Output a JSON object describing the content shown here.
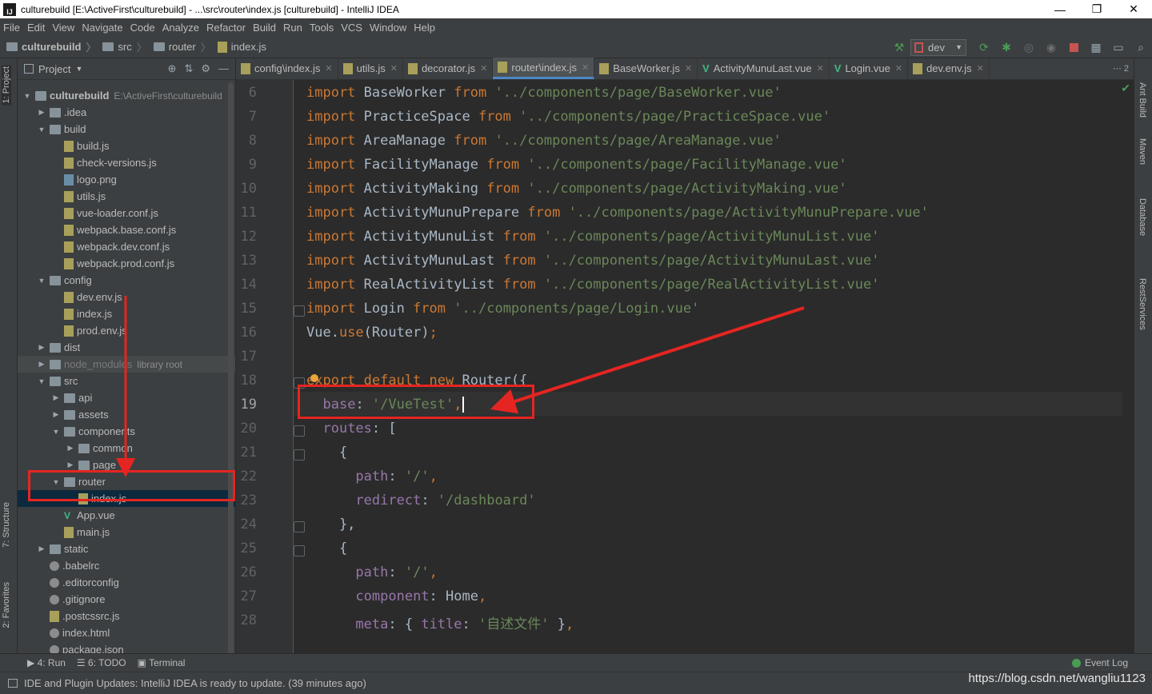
{
  "window": {
    "title": "culturebuild [E:\\ActiveFirst\\culturebuild] - ...\\src\\router\\index.js [culturebuild] - IntelliJ IDEA",
    "minimize": "—",
    "maximize": "❐",
    "close": "✕",
    "app_icon": "IJ"
  },
  "menu": [
    "File",
    "Edit",
    "View",
    "Navigate",
    "Code",
    "Analyze",
    "Refactor",
    "Build",
    "Run",
    "Tools",
    "VCS",
    "Window",
    "Help"
  ],
  "breadcrumb": {
    "project": "culturebuild",
    "folder1": "src",
    "folder2": "router",
    "file": "index.js"
  },
  "toolbar": {
    "run_config": "dev",
    "icons": [
      "hammer-icon",
      "run-icon",
      "debug-icon",
      "coverage-icon",
      "profile-icon",
      "stop-icon",
      "project-structure-icon",
      "layout-icon",
      "search-everywhere-icon"
    ]
  },
  "left_stripe": {
    "project": "1: Project",
    "structure": "7: Structure",
    "favorites": "2: Favorites"
  },
  "project_panel": {
    "title": "Project",
    "tree": [
      {
        "label": "culturebuild",
        "sub": "E:\\ActiveFirst\\culturebuild",
        "depth": 0,
        "arrow": "▼",
        "icon": "folder",
        "bold": true
      },
      {
        "label": ".idea",
        "depth": 1,
        "arrow": "▶",
        "icon": "folder"
      },
      {
        "label": "build",
        "depth": 1,
        "arrow": "▼",
        "icon": "folder"
      },
      {
        "label": "build.js",
        "depth": 2,
        "arrow": "",
        "icon": "js"
      },
      {
        "label": "check-versions.js",
        "depth": 2,
        "arrow": "",
        "icon": "js"
      },
      {
        "label": "logo.png",
        "depth": 2,
        "arrow": "",
        "icon": "png"
      },
      {
        "label": "utils.js",
        "depth": 2,
        "arrow": "",
        "icon": "js"
      },
      {
        "label": "vue-loader.conf.js",
        "depth": 2,
        "arrow": "",
        "icon": "js"
      },
      {
        "label": "webpack.base.conf.js",
        "depth": 2,
        "arrow": "",
        "icon": "js"
      },
      {
        "label": "webpack.dev.conf.js",
        "depth": 2,
        "arrow": "",
        "icon": "js"
      },
      {
        "label": "webpack.prod.conf.js",
        "depth": 2,
        "arrow": "",
        "icon": "js"
      },
      {
        "label": "config",
        "depth": 1,
        "arrow": "▼",
        "icon": "folder"
      },
      {
        "label": "dev.env.js",
        "depth": 2,
        "arrow": "",
        "icon": "js"
      },
      {
        "label": "index.js",
        "depth": 2,
        "arrow": "",
        "icon": "js"
      },
      {
        "label": "prod.env.js",
        "depth": 2,
        "arrow": "",
        "icon": "js"
      },
      {
        "label": "dist",
        "depth": 1,
        "arrow": "▶",
        "icon": "folder"
      },
      {
        "label": "node_modules",
        "sub": "library root",
        "depth": 1,
        "arrow": "▶",
        "icon": "folder",
        "dim": true
      },
      {
        "label": "src",
        "depth": 1,
        "arrow": "▼",
        "icon": "folder"
      },
      {
        "label": "api",
        "depth": 2,
        "arrow": "▶",
        "icon": "folder"
      },
      {
        "label": "assets",
        "depth": 2,
        "arrow": "▶",
        "icon": "folder"
      },
      {
        "label": "components",
        "depth": 2,
        "arrow": "▼",
        "icon": "folder"
      },
      {
        "label": "common",
        "depth": 3,
        "arrow": "▶",
        "icon": "folder"
      },
      {
        "label": "page",
        "depth": 3,
        "arrow": "▶",
        "icon": "folder"
      },
      {
        "label": "router",
        "depth": 2,
        "arrow": "▼",
        "icon": "folder"
      },
      {
        "label": "index.js",
        "depth": 3,
        "arrow": "",
        "icon": "js",
        "selected": true
      },
      {
        "label": "App.vue",
        "depth": 2,
        "arrow": "",
        "icon": "vue"
      },
      {
        "label": "main.js",
        "depth": 2,
        "arrow": "",
        "icon": "js"
      },
      {
        "label": "static",
        "depth": 1,
        "arrow": "▶",
        "icon": "folder"
      },
      {
        "label": ".babelrc",
        "depth": 1,
        "arrow": "",
        "icon": "cfg"
      },
      {
        "label": ".editorconfig",
        "depth": 1,
        "arrow": "",
        "icon": "cfg"
      },
      {
        "label": ".gitignore",
        "depth": 1,
        "arrow": "",
        "icon": "cfg"
      },
      {
        "label": ".postcssrc.js",
        "depth": 1,
        "arrow": "",
        "icon": "js"
      },
      {
        "label": "index.html",
        "depth": 1,
        "arrow": "",
        "icon": "cfg"
      },
      {
        "label": "package.json",
        "depth": 1,
        "arrow": "",
        "icon": "cfg"
      }
    ]
  },
  "tabs": [
    {
      "label": "config\\index.js",
      "icon": "js"
    },
    {
      "label": "utils.js",
      "icon": "js"
    },
    {
      "label": "decorator.js",
      "icon": "js"
    },
    {
      "label": "router\\index.js",
      "icon": "js",
      "active": true
    },
    {
      "label": "BaseWorker.js",
      "icon": "js"
    },
    {
      "label": "ActivityMunuLast.vue",
      "icon": "vue"
    },
    {
      "label": "Login.vue",
      "icon": "vue"
    },
    {
      "label": "dev.env.js",
      "icon": "js"
    }
  ],
  "tabs_more": "⋯ 2",
  "editor": {
    "current_line": 19,
    "lines": [
      {
        "n": "6",
        "tokens": [
          [
            "kw",
            "import"
          ],
          [
            "t",
            " BaseWorker "
          ],
          [
            "kw",
            "from"
          ],
          [
            "t",
            " "
          ],
          [
            "str",
            "'../components/page/BaseWorker.vue'"
          ]
        ]
      },
      {
        "n": "7",
        "tokens": [
          [
            "kw",
            "import"
          ],
          [
            "t",
            " PracticeSpace "
          ],
          [
            "kw",
            "from"
          ],
          [
            "t",
            " "
          ],
          [
            "str",
            "'../components/page/PracticeSpace.vue'"
          ]
        ]
      },
      {
        "n": "8",
        "tokens": [
          [
            "kw",
            "import"
          ],
          [
            "t",
            " AreaManage "
          ],
          [
            "kw",
            "from"
          ],
          [
            "t",
            " "
          ],
          [
            "str",
            "'../components/page/AreaManage.vue'"
          ]
        ]
      },
      {
        "n": "9",
        "tokens": [
          [
            "kw",
            "import"
          ],
          [
            "t",
            " FacilityManage "
          ],
          [
            "kw",
            "from"
          ],
          [
            "t",
            " "
          ],
          [
            "str",
            "'../components/page/FacilityManage.vue'"
          ]
        ]
      },
      {
        "n": "10",
        "tokens": [
          [
            "kw",
            "import"
          ],
          [
            "t",
            " ActivityMaking "
          ],
          [
            "kw",
            "from"
          ],
          [
            "t",
            " "
          ],
          [
            "str",
            "'../components/page/ActivityMaking.vue'"
          ]
        ]
      },
      {
        "n": "11",
        "tokens": [
          [
            "kw",
            "import"
          ],
          [
            "t",
            " ActivityMunuPrepare "
          ],
          [
            "kw",
            "from"
          ],
          [
            "t",
            " "
          ],
          [
            "str",
            "'../components/page/ActivityMunuPrepare.vue'"
          ]
        ]
      },
      {
        "n": "12",
        "tokens": [
          [
            "kw",
            "import"
          ],
          [
            "t",
            " ActivityMunuList "
          ],
          [
            "kw",
            "from"
          ],
          [
            "t",
            " "
          ],
          [
            "str",
            "'../components/page/ActivityMunuList.vue'"
          ]
        ]
      },
      {
        "n": "13",
        "tokens": [
          [
            "kw",
            "import"
          ],
          [
            "t",
            " ActivityMunuLast "
          ],
          [
            "kw",
            "from"
          ],
          [
            "t",
            " "
          ],
          [
            "str",
            "'../components/page/ActivityMunuLast.vue'"
          ]
        ]
      },
      {
        "n": "14",
        "tokens": [
          [
            "kw",
            "import"
          ],
          [
            "t",
            " RealActivityList "
          ],
          [
            "kw",
            "from"
          ],
          [
            "t",
            " "
          ],
          [
            "str",
            "'../components/page/RealActivityList.vue'"
          ]
        ]
      },
      {
        "n": "15",
        "tokens": [
          [
            "kw",
            "import"
          ],
          [
            "t",
            " Login "
          ],
          [
            "kw",
            "from"
          ],
          [
            "t",
            " "
          ],
          [
            "str",
            "'../components/page/Login.vue'"
          ]
        ]
      },
      {
        "n": "16",
        "tokens": [
          [
            "t",
            "Vue."
          ],
          [
            "kw",
            "use"
          ],
          [
            "t",
            "(Router)"
          ],
          [
            "kw",
            ";"
          ]
        ]
      },
      {
        "n": "17",
        "tokens": []
      },
      {
        "n": "18",
        "tokens": [
          [
            "kw",
            "export default new"
          ],
          [
            "t",
            " Router({"
          ]
        ]
      },
      {
        "n": "19",
        "tokens": [
          [
            "t",
            "  "
          ],
          [
            "prop",
            "base"
          ],
          [
            "t",
            ": "
          ],
          [
            "str",
            "'/VueTest'"
          ],
          [
            "kw",
            ","
          ]
        ],
        "caret": true
      },
      {
        "n": "20",
        "tokens": [
          [
            "t",
            "  "
          ],
          [
            "prop",
            "routes"
          ],
          [
            "t",
            ": ["
          ]
        ]
      },
      {
        "n": "21",
        "tokens": [
          [
            "t",
            "    {"
          ]
        ]
      },
      {
        "n": "22",
        "tokens": [
          [
            "t",
            "      "
          ],
          [
            "prop",
            "path"
          ],
          [
            "t",
            ": "
          ],
          [
            "str",
            "'/'"
          ],
          [
            "kw",
            ","
          ]
        ]
      },
      {
        "n": "23",
        "tokens": [
          [
            "t",
            "      "
          ],
          [
            "prop",
            "redirect"
          ],
          [
            "t",
            ": "
          ],
          [
            "str",
            "'/dashboard'"
          ]
        ]
      },
      {
        "n": "24",
        "tokens": [
          [
            "t",
            "    },"
          ]
        ]
      },
      {
        "n": "25",
        "tokens": [
          [
            "t",
            "    {"
          ]
        ]
      },
      {
        "n": "26",
        "tokens": [
          [
            "t",
            "      "
          ],
          [
            "prop",
            "path"
          ],
          [
            "t",
            ": "
          ],
          [
            "str",
            "'/'"
          ],
          [
            "kw",
            ","
          ]
        ]
      },
      {
        "n": "27",
        "tokens": [
          [
            "t",
            "      "
          ],
          [
            "prop",
            "component"
          ],
          [
            "t",
            ": Home"
          ],
          [
            "kw",
            ","
          ]
        ]
      },
      {
        "n": "28",
        "tokens": [
          [
            "t",
            "      "
          ],
          [
            "prop",
            "meta"
          ],
          [
            "t",
            ": { "
          ],
          [
            "prop",
            "title"
          ],
          [
            "t",
            ": "
          ],
          [
            "str",
            "'自述文件'"
          ],
          [
            "t",
            " }"
          ],
          [
            "kw",
            ","
          ]
        ]
      }
    ]
  },
  "right_stripe": [
    "Ant Build",
    "Maven",
    "Database",
    "RestServices"
  ],
  "bottom_tools": {
    "run": "4: Run",
    "todo": "6: TODO",
    "terminal": "Terminal",
    "event_log": "Event Log"
  },
  "status": {
    "message": "IDE and Plugin Updates: IntelliJ IDEA is ready to update. (39 minutes ago)",
    "watermark": "https://blog.csdn.net/wangliu1123"
  },
  "colors": {
    "annotation": "#e52521",
    "keyword": "#cc7832",
    "string": "#6a8759",
    "property": "#9876aa",
    "selection": "#0d293e"
  }
}
